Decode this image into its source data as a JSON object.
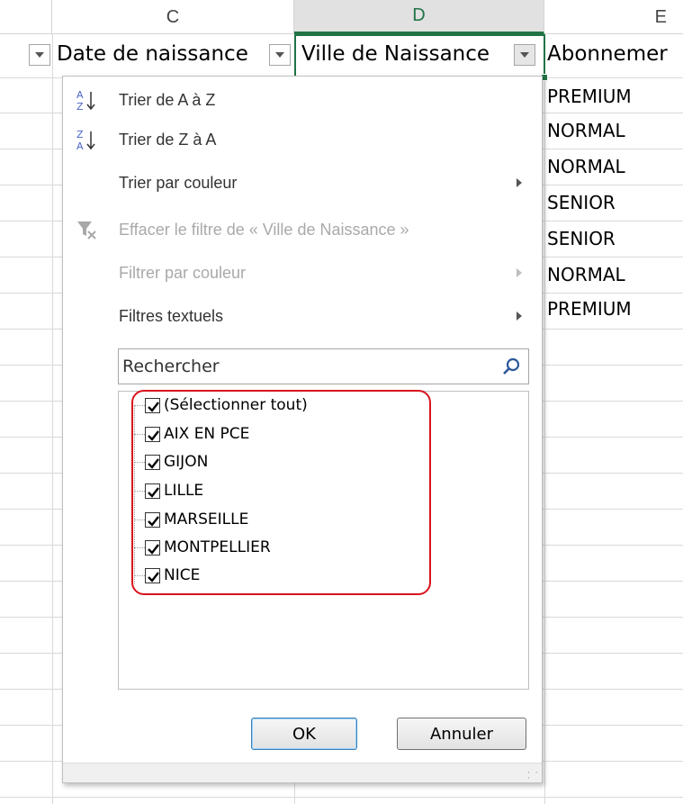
{
  "columns": {
    "c": "C",
    "d": "D",
    "e": "E"
  },
  "headers": {
    "date_naissance": "Date de naissance",
    "ville_naissance": "Ville de Naissance",
    "abonnement": "Abonnemer"
  },
  "column_e_values": [
    "PREMIUM",
    "NORMAL",
    "NORMAL",
    "SENIOR",
    "SENIOR",
    "NORMAL",
    "PREMIUM"
  ],
  "menu": {
    "sort_az": "Trier de A à Z",
    "sort_za": "Trier de Z à A",
    "sort_color": "Trier par couleur",
    "clear_filter": "Effacer le filtre de « Ville de Naissance »",
    "filter_color": "Filtrer par couleur",
    "text_filters": "Filtres textuels"
  },
  "search": {
    "placeholder": "Rechercher"
  },
  "list": {
    "select_all": "(Sélectionner tout)",
    "items": [
      "AIX EN PCE",
      "GIJON",
      "LILLE",
      "MARSEILLE",
      "MONTPELLIER",
      "NICE"
    ]
  },
  "buttons": {
    "ok": "OK",
    "cancel": "Annuler"
  },
  "colors": {
    "accent_green": "#217346",
    "highlight_red": "#d9141e"
  }
}
